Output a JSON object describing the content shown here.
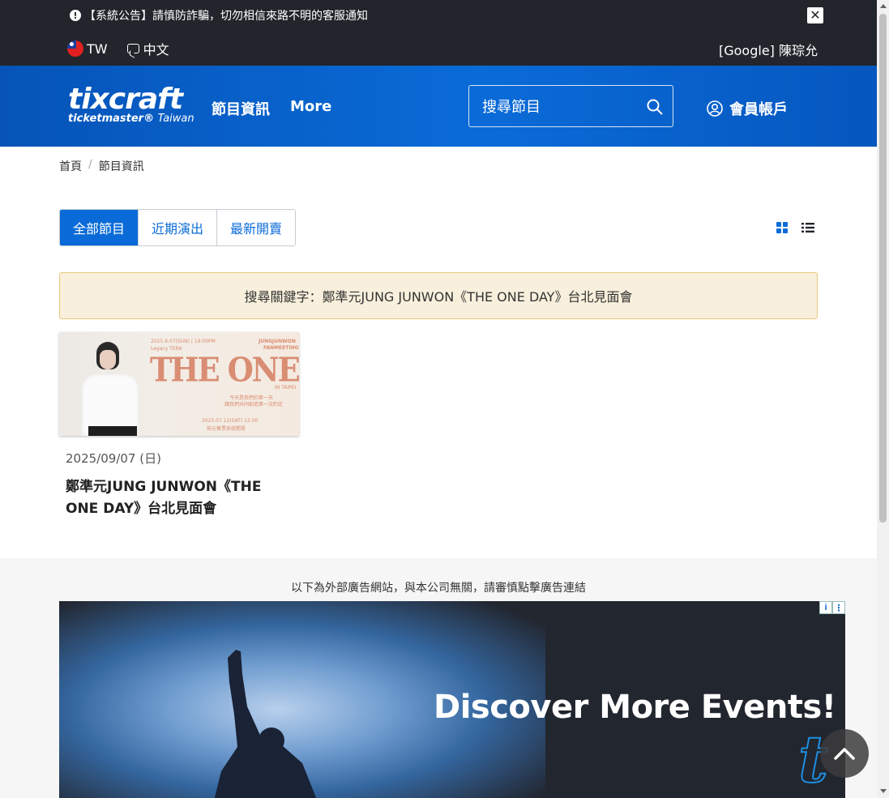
{
  "notice": {
    "text": "【系統公告】請慎防詐騙，切勿相信來路不明的客服通知",
    "close_icon": "close-icon"
  },
  "locale": {
    "region": "TW",
    "language": "中文"
  },
  "user": {
    "display_name": "[Google] 陳琮允"
  },
  "header": {
    "logo_main": "tixcraft",
    "logo_sub": "ticketmaster",
    "logo_region": "Taiwan",
    "nav": [
      "節目資訊",
      "More"
    ],
    "search_placeholder": "搜尋節目",
    "account_label": "會員帳戶"
  },
  "breadcrumb": [
    "首頁",
    "節目資訊"
  ],
  "tabs": [
    {
      "label": "全部節目",
      "active": true
    },
    {
      "label": "近期演出",
      "active": false
    },
    {
      "label": "最新開賣",
      "active": false
    }
  ],
  "view_modes": [
    "grid-view-icon",
    "list-view-icon"
  ],
  "search_keyword_banner": "搜尋關鍵字：鄭準元JUNG JUNWON《THE ONE DAY》台北見面會",
  "events": [
    {
      "date": "2025/09/07 (日)",
      "title": "鄭準元JUNG JUNWON《THE ONE DAY》台北見面會",
      "poster": {
        "headline": "THE ONE DAY",
        "date_line": "2025.9.07(SUN) | 19:00PM",
        "venue": "Legacy TERA",
        "artist": "JUNGJUNWON",
        "event_type": "FANMEETING",
        "city": "IN TAIPEI",
        "blurb_1": "今天是我們的第一天",
        "blurb_2": "讓我們共同創造第一次約定",
        "sale_line": "2025.07.12(SAT) 12:00",
        "sale_note": "拓元售票系統開賣"
      }
    }
  ],
  "ad_section": {
    "disclaimer": "以下為外部廣告網站，與本公司無關，請審慎點擊廣告連結",
    "ad_headline": "Discover More Events!",
    "ad_brand_mark": "t",
    "info_icon": "i",
    "menu_icon": "⋮"
  },
  "colors": {
    "primary": "#0a6bd8",
    "topbar": "#22252b",
    "banner_bg": "#f8f0dc",
    "banner_border": "#e8c87a"
  }
}
